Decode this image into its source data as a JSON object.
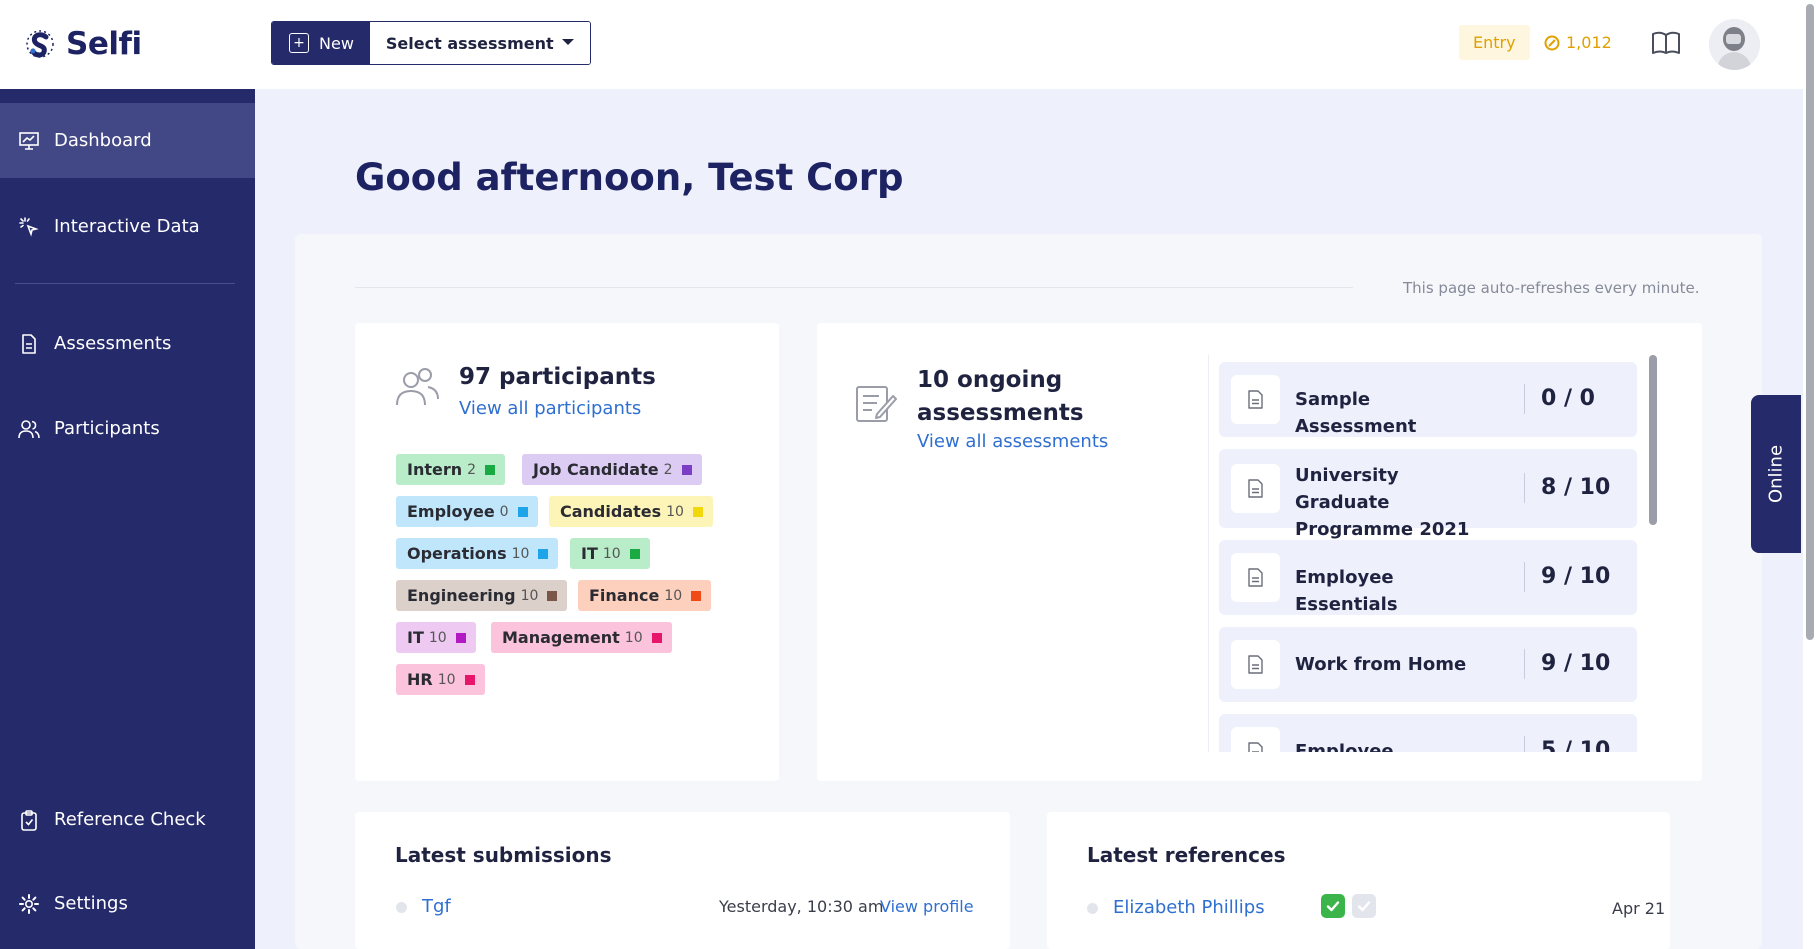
{
  "brand": {
    "name": "Selfi"
  },
  "toolbar": {
    "new_label": "New",
    "select_label": "Select assessment"
  },
  "account": {
    "plan": "Entry",
    "credits": "1,012"
  },
  "sidebar": {
    "items": [
      {
        "label": "Dashboard"
      },
      {
        "label": "Interactive Data"
      },
      {
        "label": "Assessments"
      },
      {
        "label": "Participants"
      },
      {
        "label": "Reference Check"
      },
      {
        "label": "Settings"
      }
    ]
  },
  "main": {
    "greeting": "Good afternoon, Test Corp",
    "autorefresh": "This page auto-refreshes every minute.",
    "participants": {
      "count_label": "97 participants",
      "link": "View all participants",
      "tags": [
        {
          "name": "Intern",
          "count": "2",
          "bg": "#b9ecc9",
          "color": "#1aaa44"
        },
        {
          "name": "Job Candidate",
          "count": "2",
          "bg": "#dccbf2",
          "color": "#7c3ec4"
        },
        {
          "name": "Employee",
          "count": "0",
          "bg": "#bfe6fb",
          "color": "#1ea4e8"
        },
        {
          "name": "Candidates",
          "count": "10",
          "bg": "#fdf5b8",
          "color": "#f2d70c"
        },
        {
          "name": "Operations",
          "count": "10",
          "bg": "#bfe6fb",
          "color": "#1ea4e8"
        },
        {
          "name": "IT",
          "count": "10",
          "bg": "#b9ecc9",
          "color": "#1aaa44"
        },
        {
          "name": "Engineering",
          "count": "10",
          "bg": "#dcd0cb",
          "color": "#7a5648"
        },
        {
          "name": "Finance",
          "count": "10",
          "bg": "#fcd0bd",
          "color": "#f04a16"
        },
        {
          "name": "IT",
          "count": "10",
          "bg": "#eecaf2",
          "color": "#b319c2"
        },
        {
          "name": "Management",
          "count": "10",
          "bg": "#fbc3dc",
          "color": "#e8166b"
        },
        {
          "name": "HR",
          "count": "10",
          "bg": "#fbc3dc",
          "color": "#e8166b"
        }
      ]
    },
    "assessments": {
      "count_label": "10 ongoing assessments",
      "link": "View all assessments",
      "items": [
        {
          "name": "Sample Assessment",
          "score": "0 / 0"
        },
        {
          "name": "University Graduate Programme 2021",
          "score": "8 / 10"
        },
        {
          "name": "Employee Essentials",
          "score": "9 / 10"
        },
        {
          "name": "Work from Home",
          "score": "9 / 10"
        },
        {
          "name": "Employee Satisfaction",
          "score": "5 / 10"
        }
      ]
    },
    "online_tab": "Online",
    "submissions": {
      "title": "Latest submissions",
      "rows": [
        {
          "name": "Tgf",
          "time": "Yesterday, 10:30 am",
          "action": "View profile"
        }
      ]
    },
    "references": {
      "title": "Latest references",
      "rows": [
        {
          "name": "Elizabeth Phillips",
          "date": "Apr 21"
        }
      ]
    }
  },
  "colors": {
    "navy": "#252a6b",
    "link": "#2f6fd0",
    "coin": "#e0a100",
    "check_green": "#3bb54a"
  }
}
